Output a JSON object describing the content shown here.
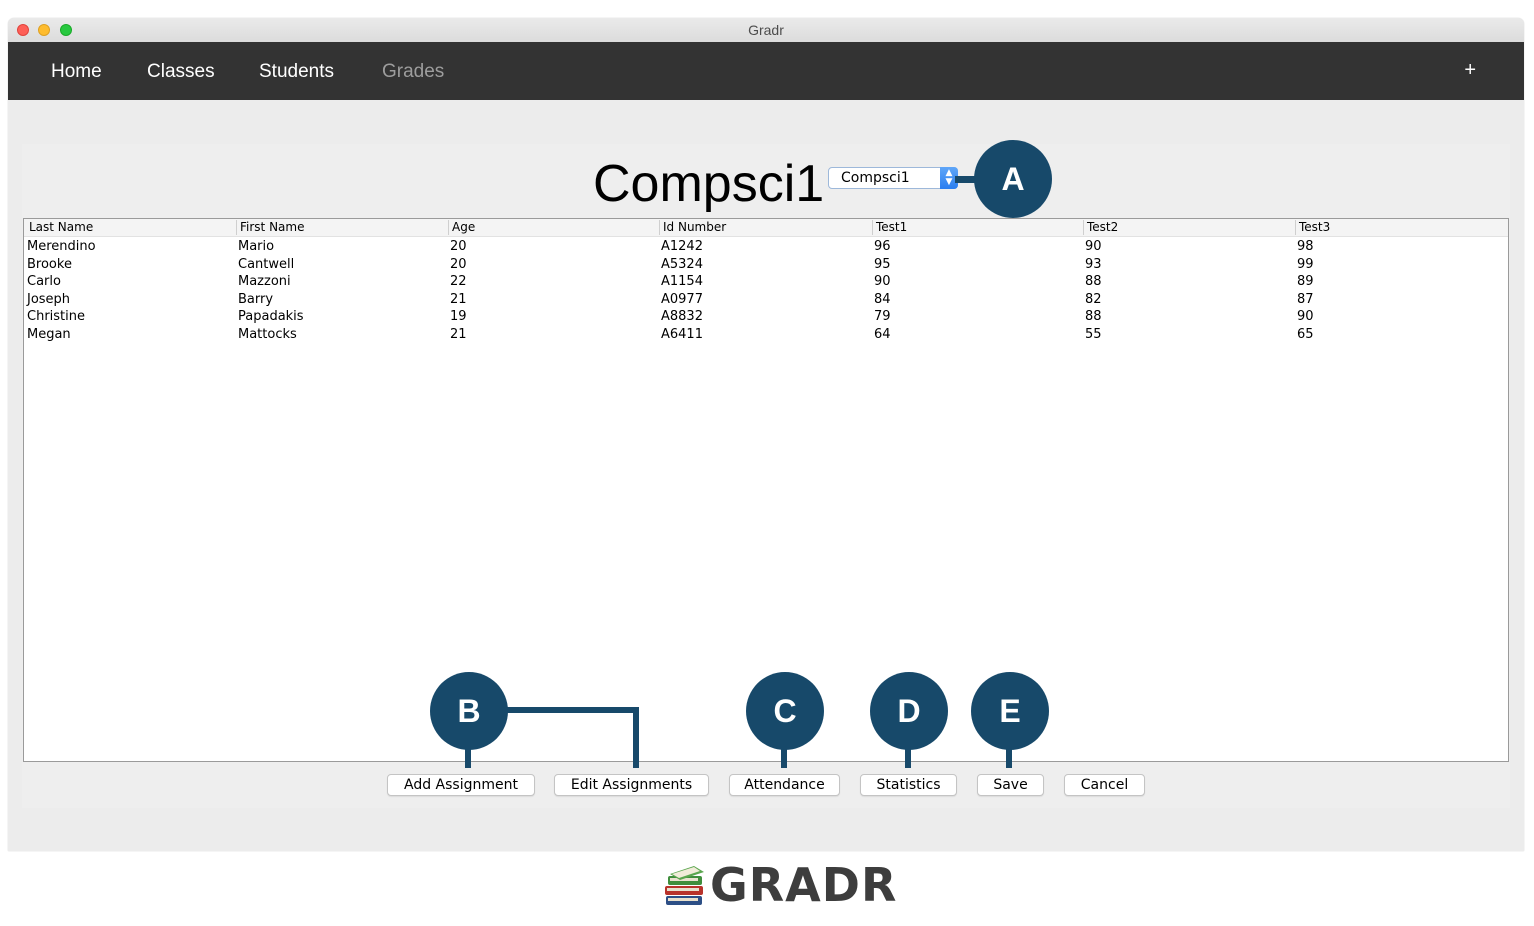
{
  "window": {
    "title": "Gradr"
  },
  "nav": {
    "items": [
      {
        "label": "Home"
      },
      {
        "label": "Classes"
      },
      {
        "label": "Students"
      },
      {
        "label": "Grades"
      }
    ],
    "add_label": "+"
  },
  "class_view": {
    "title": "Compsci1",
    "selector_value": "Compsci1",
    "selector_icon": "up-down-arrows-icon"
  },
  "table": {
    "columns": [
      "Last Name",
      "First Name",
      "Age",
      "Id Number",
      "Test1",
      "Test2",
      "Test3"
    ],
    "rows": [
      [
        "Merendino",
        "Mario",
        "20",
        "A1242",
        "96",
        "90",
        "98"
      ],
      [
        "Brooke",
        "Cantwell",
        "20",
        "A5324",
        "95",
        "93",
        "99"
      ],
      [
        "Carlo",
        "Mazzoni",
        "22",
        "A1154",
        "90",
        "88",
        "89"
      ],
      [
        "Joseph",
        "Barry",
        "21",
        "A0977",
        "84",
        "82",
        "87"
      ],
      [
        "Christine",
        "Papadakis",
        "19",
        "A8832",
        "79",
        "88",
        "90"
      ],
      [
        "Megan",
        "Mattocks",
        "21",
        "A6411",
        "64",
        "55",
        "65"
      ]
    ]
  },
  "buttons": {
    "add_assignment": "Add Assignment",
    "edit_assignments": "Edit Assignments",
    "attendance": "Attendance",
    "statistics": "Statistics",
    "save": "Save",
    "cancel": "Cancel"
  },
  "callouts": {
    "a": "A",
    "b": "B",
    "c": "C",
    "d": "D",
    "e": "E"
  },
  "logo": {
    "text": "GRADR",
    "icon": "books-stack-icon"
  },
  "colors": {
    "navbar": "#333333",
    "callout": "#17496a",
    "nav_active": "#9d9d9d"
  }
}
